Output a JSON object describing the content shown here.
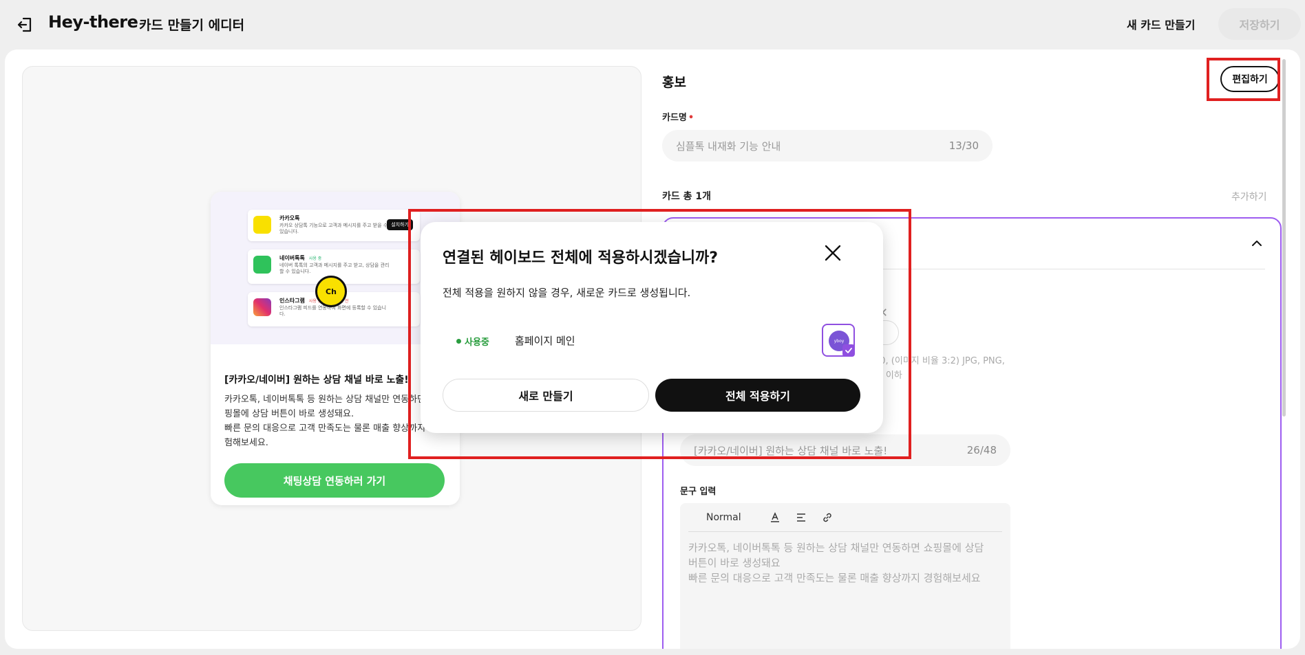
{
  "header": {
    "brand": "Hey-there",
    "subtitle": "카드 만들기 에디터",
    "new_card": "새 카드 만들기",
    "save": "저장하기"
  },
  "preview": {
    "mini_items": [
      {
        "name": "카카오톡",
        "desc": "카카오 상담톡 기능으로 고객과 메시지를 주고 받을 수 있습니다.",
        "action": "설치하기"
      },
      {
        "name": "네이버톡톡",
        "tag": "사용 중",
        "desc": "네이버 톡톡의 고객과 메시지를 주고 받고, 상담을 관리할 수 있습니다."
      },
      {
        "name": "인스타그램",
        "tag": "사용 중 · 만료 60일 전",
        "desc": "인스타그램 피드를 연동하여 화면에 등록할 수 있습니다."
      }
    ],
    "badge": "Ch",
    "card_title": "[카카오/네이버] 원하는 상담 채널 바로 노출!",
    "card_desc": "카카오톡, 네이버톡톡 등 원하는 상담 채널만 연동하면 쇼\n핑몰에 상담 버튼이 바로 생성돼요.\n빠른 문의 대응으로 고객 만족도는 물론 매출 향상까지 경\n험해보세요.",
    "card_button": "채팅상담 연동하러 가기"
  },
  "form": {
    "section_title": "홍보",
    "edit_button": "편집하기",
    "card_name_label": "카드명",
    "required_mark": "•",
    "card_name_value": "심플톡 내재화 기능 안내",
    "card_name_count": "13/30",
    "card_total_label": "카드 총 1개",
    "add_link": "추가하기",
    "image_help_line1": "40, (이미지 비율 3:2) JPG, PNG,",
    "image_help_line2": "IB 이하",
    "headline_value": "[카카오/네이버] 원하는 상담 채널 바로 노출!",
    "headline_count": "26/48",
    "body_label": "문구 입력",
    "toolbar_normal": "Normal",
    "body_text_line1": "카카오톡, 네이버톡톡 등 원하는 상담 채널만 연동하면 쇼핑몰에 상담",
    "body_text_line2": "버튼이 바로 생성돼요",
    "body_text_line3": "빠른 문의 대응으로 고객 만족도는 물론 매출 향상까지 경험해보세요"
  },
  "modal": {
    "title": "연결된 헤이보드 전체에 적용하시겠습니까?",
    "description": "전체 적용을 원하지 않을 경우, 새로운 카드로 생성됩니다.",
    "status": "사용중",
    "page_name": "홈페이지 메인",
    "thumb_text": "yboy",
    "new_button": "새로 만들기",
    "apply_button": "전체 적용하기"
  },
  "colors": {
    "accent_purple": "#9d5cf0",
    "green": "#47c85f",
    "highlight_red": "#e02020"
  }
}
